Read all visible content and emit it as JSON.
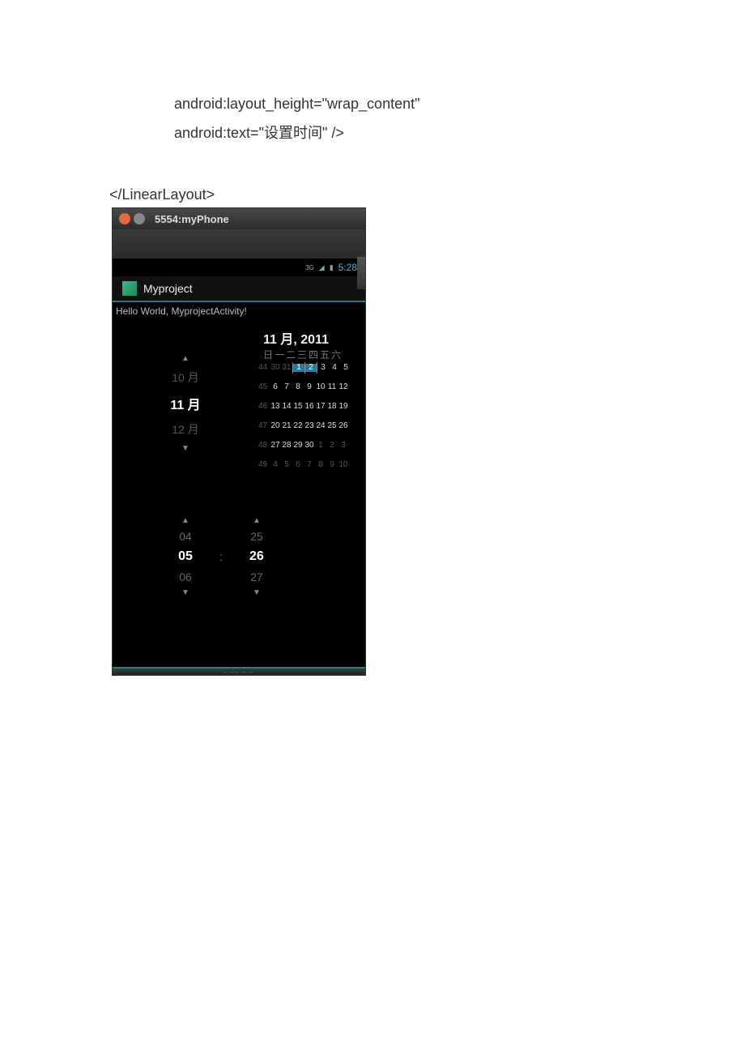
{
  "code": {
    "line1": "android:layout_height=\"wrap_content\"",
    "line2": "android:text=\"设置时间\" />",
    "closing": "</LinearLayout>"
  },
  "emulator": {
    "title": "5554:myPhone",
    "status": {
      "net": "3G",
      "time": "5:28"
    },
    "app": {
      "name": "Myproject",
      "hello": "Hello World, MyprojectActivity!"
    },
    "calendar": {
      "header": "11 月, 2011",
      "dow": "日一二三四五六",
      "month_prev": "10 月",
      "month_cur": "11 月",
      "month_next": "12 月",
      "rows": [
        {
          "wk": "44",
          "d": [
            "30",
            "31",
            "1",
            "2",
            "3",
            "4",
            "5"
          ],
          "dim": [
            0,
            1
          ],
          "sel": [
            2,
            3
          ]
        },
        {
          "wk": "45",
          "d": [
            "6",
            "7",
            "8",
            "9",
            "10",
            "11",
            "12"
          ],
          "dim": [],
          "sel": []
        },
        {
          "wk": "46",
          "d": [
            "13",
            "14",
            "15",
            "16",
            "17",
            "18",
            "19"
          ],
          "dim": [],
          "sel": []
        },
        {
          "wk": "47",
          "d": [
            "20",
            "21",
            "22",
            "23",
            "24",
            "25",
            "26"
          ],
          "dim": [],
          "sel": []
        },
        {
          "wk": "48",
          "d": [
            "27",
            "28",
            "29",
            "30",
            "1",
            "2",
            "3"
          ],
          "dim": [
            4,
            5,
            6
          ],
          "sel": []
        },
        {
          "wk": "49",
          "d": [
            "4",
            "5",
            "6",
            "7",
            "8",
            "9",
            "10"
          ],
          "dim": [
            0,
            1,
            2,
            3,
            4,
            5,
            6
          ],
          "sel": []
        }
      ]
    },
    "time": {
      "hour": {
        "prev": "04",
        "cur": "05",
        "next": "06"
      },
      "min": {
        "prev": "25",
        "cur": "26",
        "next": "27"
      }
    }
  }
}
